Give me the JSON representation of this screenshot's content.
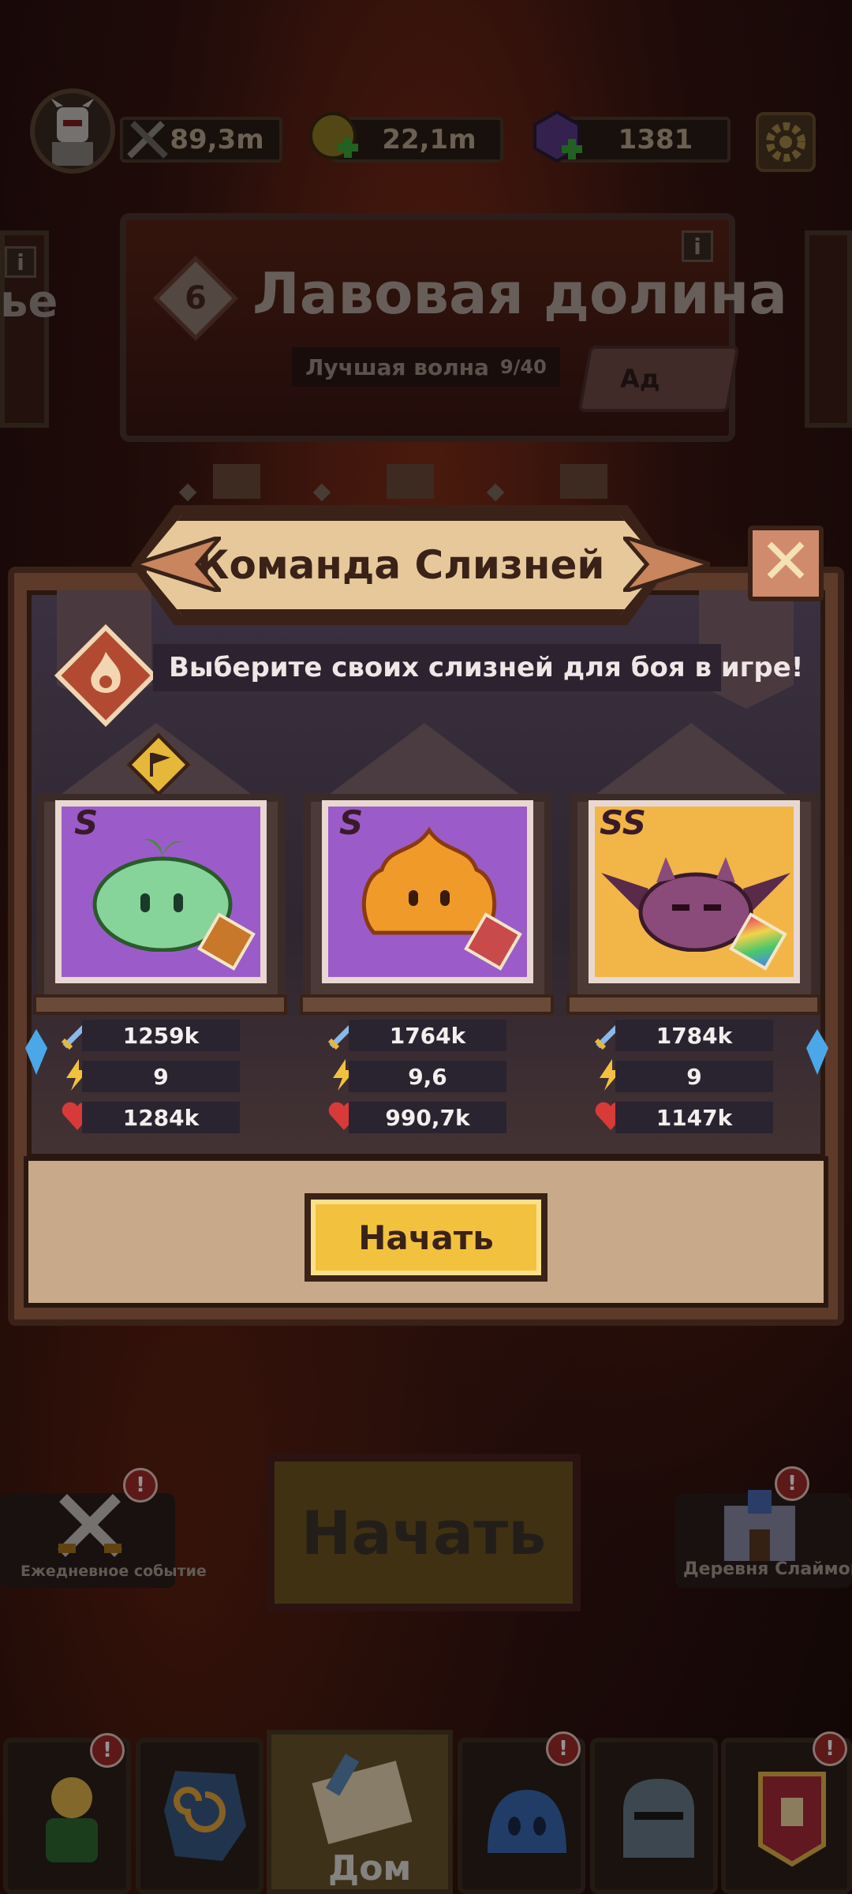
{
  "top_bar": {
    "power": "89,3m",
    "gold": "22,1m",
    "gems": "1381"
  },
  "level": {
    "number": "6",
    "name": "Лавовая долина",
    "best_wave_label": "Лучшая волна",
    "best_wave_value": "9/40",
    "difficulty": "Ад",
    "info": "i"
  },
  "side_card_left": {
    "text": "ье",
    "info": "i"
  },
  "dialog": {
    "title": "Команда Слизней",
    "close": "✕",
    "hint": "Выберите своих слизней для боя в игре!",
    "start": "Начать",
    "slimes": [
      {
        "grade": "S",
        "kind": "green",
        "attack": "1259k",
        "speed": "9",
        "hp": "1284k"
      },
      {
        "grade": "S",
        "kind": "fire",
        "attack": "1764k",
        "speed": "9,6",
        "hp": "990,7k"
      },
      {
        "grade": "SS",
        "kind": "bat",
        "attack": "1784k",
        "speed": "9",
        "hp": "1147k"
      }
    ]
  },
  "main": {
    "start": "Начать",
    "daily_event": "Ежедневное событие",
    "slime_village": "Деревня Слаймов",
    "badge": "!"
  },
  "nav": {
    "home": "Дом"
  },
  "colors": {
    "accent_gold": "#f2c23e",
    "card_purple": "#9b5cc9",
    "card_gold": "#f2b648",
    "alert_red": "#a02a2a"
  }
}
